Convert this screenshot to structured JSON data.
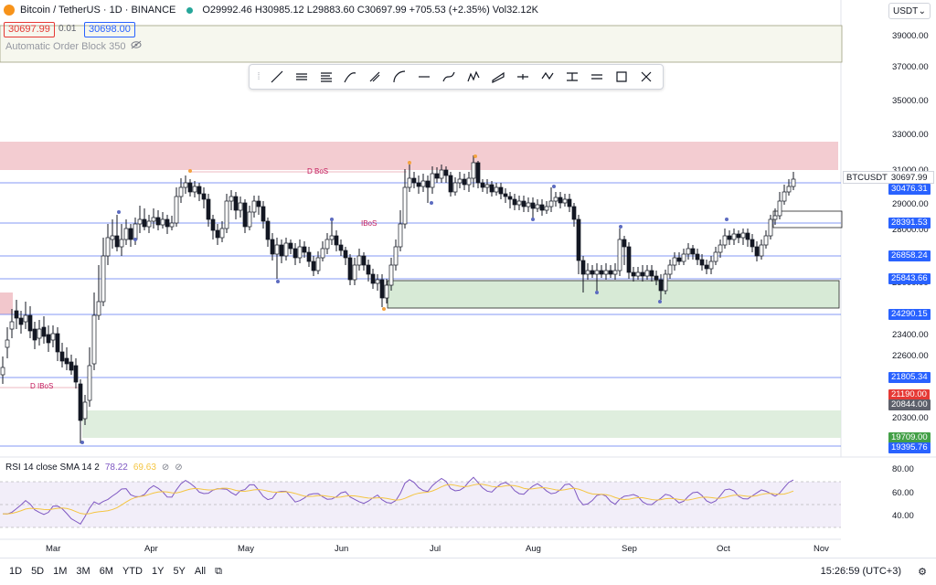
{
  "header": {
    "symbol": "Bitcoin / TetherUS · 1D · BINANCE",
    "ohlc": "O29992.46 H30985.12 L29883.60 C30697.99 +705.53 (+2.35%) Vol32.12K",
    "sell_price": "30697.99",
    "spread": "0.01",
    "buy_price": "30698.00",
    "indicator_label": "Automatic Order Block 350",
    "currency": "USDT"
  },
  "y_axis": {
    "ticks": [
      "39000.00",
      "37000.00",
      "35000.00",
      "33000.00",
      "31000.00",
      "29000.00",
      "28000.00",
      "25000.00",
      "23400.00",
      "22600.00",
      "20300.00"
    ],
    "symbol_tag": "BTCUSDT",
    "last_price": "30697.99"
  },
  "level_tags": [
    {
      "text": "30476.31",
      "bg": "#2962ff"
    },
    {
      "text": "28391.53",
      "bg": "#2962ff"
    },
    {
      "text": "26858.24",
      "bg": "#2962ff"
    },
    {
      "text": "25843.66",
      "bg": "#2962ff"
    },
    {
      "text": "24290.15",
      "bg": "#2962ff"
    },
    {
      "text": "21805.34",
      "bg": "#2962ff"
    },
    {
      "text": "21190.00",
      "bg": "#e53935"
    },
    {
      "text": "20844.00",
      "bg": "#5d606b"
    },
    {
      "text": "19709.00",
      "bg": "#43a047"
    },
    {
      "text": "19395.76",
      "bg": "#2962ff"
    }
  ],
  "annotations": {
    "dbos": "D BoS",
    "ibos": "IBoS",
    "dibos": "D IBoS"
  },
  "rsi": {
    "label": "RSI 14 close SMA 14 2",
    "value1": "78.22",
    "value2": "69.63",
    "ticks": [
      "80.00",
      "60.00",
      "40.00"
    ]
  },
  "x_axis": {
    "months": [
      "Mar",
      "Apr",
      "May",
      "Jun",
      "Jul",
      "Aug",
      "Sep",
      "Oct",
      "Nov"
    ]
  },
  "timeframes": [
    "1D",
    "5D",
    "1M",
    "3M",
    "6M",
    "YTD",
    "1Y",
    "5Y",
    "All"
  ],
  "clock": "15:26:59 (UTC+3)",
  "tools": [
    "trend-line-icon",
    "parallel-lines-icon",
    "fib-icon",
    "gann-icon",
    "pitchfork-icon",
    "arc-icon",
    "horizontal-ray-icon",
    "brush-icon",
    "pattern-icon",
    "rectangle-path-icon",
    "long-position-icon",
    "zigzag-icon",
    "projection-icon",
    "price-range-icon",
    "box-icon",
    "node-icon"
  ],
  "colors": {
    "up": "#ffffff",
    "down": "#131722",
    "bear_zone": "#f2c7cc",
    "bull_zone": "#d7ead6",
    "level": "#5b79f0",
    "rsi": "#7e57c2",
    "rsi_ma": "#f4c542"
  }
}
